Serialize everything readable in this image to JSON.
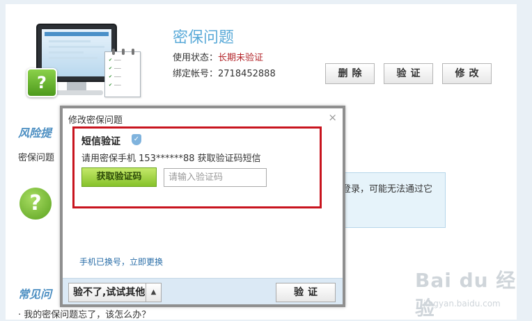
{
  "header": {
    "title": "密保问题",
    "status_label": "使用状态：",
    "status_value": "长期未验证",
    "account_label": "绑定帐号：",
    "account_value": "2718452888"
  },
  "actions": {
    "delete_label": "删除",
    "verify_label": "验证",
    "edit_label": "修改"
  },
  "background": {
    "risk_heading": "风险提",
    "risk_text": "密保问题",
    "tip_text": "登录，可能无法通过它",
    "faq_heading": "常见问",
    "faq_item": "· 我的密保问题忘了，该怎么办？"
  },
  "dialog": {
    "title": "修改密保问题",
    "close_glyph": "×",
    "sms_title": "短信验证",
    "sms_desc": "请用密保手机 153******88 获取验证码短信",
    "get_code_label": "获取验证码",
    "code_placeholder": "请输入验证码",
    "change_phone_link": "手机已换号，立即更换",
    "alt_label": "验不了,试试其他",
    "alt_arrow": "▲",
    "verify_label": "验证"
  },
  "watermark": {
    "logo": "Bai du 经验",
    "url": "jingyan.baidu.com"
  }
}
